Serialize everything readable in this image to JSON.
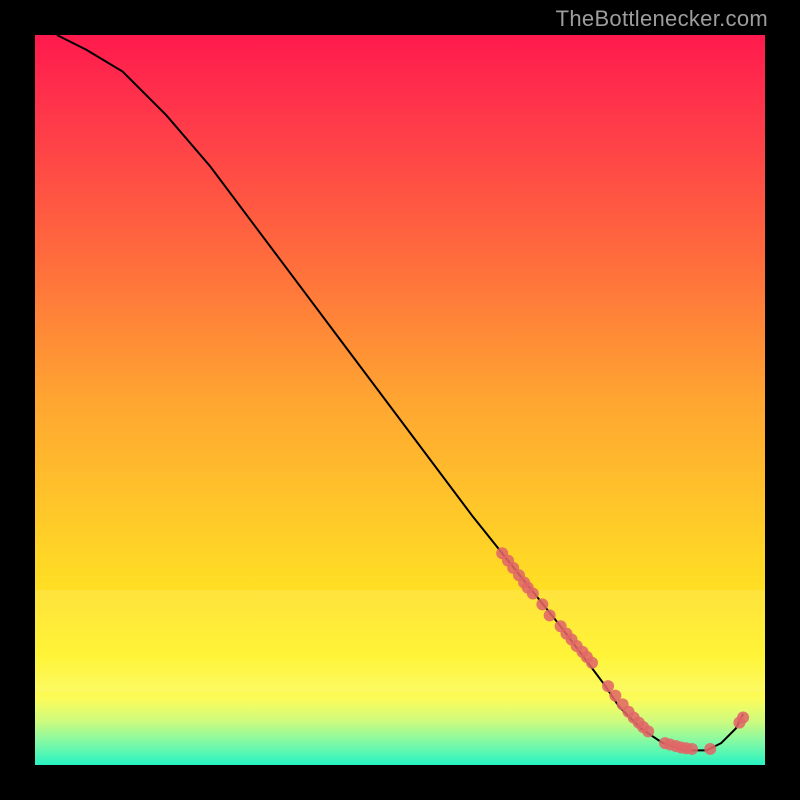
{
  "watermark": "TheBottlenecker.com",
  "chart_data": {
    "type": "line",
    "title": "",
    "xlabel": "",
    "ylabel": "",
    "xlim": [
      0,
      100
    ],
    "ylim": [
      0,
      100
    ],
    "grid": false,
    "series": [
      {
        "name": "curve",
        "x": [
          3,
          7,
          12,
          18,
          24,
          30,
          36,
          42,
          48,
          54,
          60,
          64,
          68,
          72,
          75,
          78,
          80,
          83,
          86,
          89,
          92,
          94,
          96,
          97
        ],
        "y": [
          100,
          98,
          95,
          89,
          82,
          74,
          66,
          58,
          50,
          42,
          34,
          29,
          24,
          19,
          15,
          11,
          8,
          5,
          3,
          2,
          2,
          3,
          5,
          7
        ],
        "color": "#000000"
      }
    ],
    "scatter": [
      {
        "name": "points",
        "color": "#e06666",
        "radius": 6,
        "x": [
          64.0,
          64.8,
          65.5,
          66.3,
          67.0,
          67.5,
          68.2,
          69.5,
          70.5,
          72.0,
          72.8,
          73.5,
          74.2,
          75.0,
          75.6,
          76.3,
          78.5,
          79.5,
          80.5,
          81.3,
          82.0,
          82.7,
          83.3,
          84.0,
          86.3,
          87.0,
          87.8,
          88.5,
          89.2,
          90.0,
          92.5,
          96.5,
          97.0
        ],
        "y": [
          29.0,
          28.0,
          27.0,
          26.0,
          25.0,
          24.3,
          23.5,
          22.0,
          20.5,
          19.0,
          18.0,
          17.2,
          16.3,
          15.5,
          14.8,
          14.0,
          10.8,
          9.5,
          8.3,
          7.3,
          6.5,
          5.8,
          5.2,
          4.6,
          3.0,
          2.8,
          2.6,
          2.4,
          2.3,
          2.2,
          2.2,
          5.8,
          6.5
        ]
      }
    ]
  }
}
